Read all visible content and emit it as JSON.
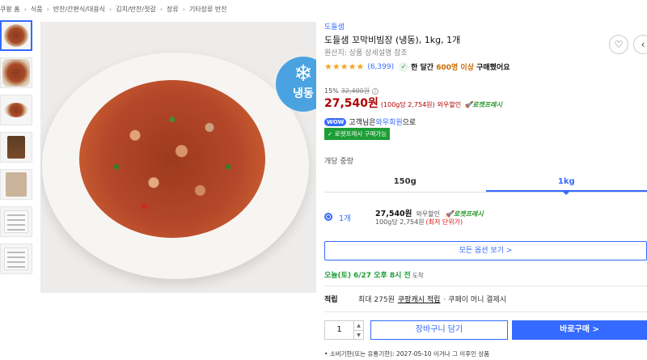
{
  "breadcrumb": [
    "쿠팡 홈",
    "식품",
    "반찬/간편식/대용식",
    "김치/반찬/젓갈",
    "장류",
    "기타장류 반찬"
  ],
  "badge": {
    "freeze_text": "냉동",
    "icon": "snowflake-icon"
  },
  "product": {
    "brand": "도들샘",
    "title": "도들샘 꼬막비빔장 (냉동), 1kg, 1개",
    "origin": "원산지: 상품 상세설명 참조",
    "stars": "★★★★★",
    "review_count": "(6,399)",
    "bought_prefix": "한 달간 ",
    "bought_highlight": "600명 이상",
    "bought_suffix": " 구매했어요"
  },
  "price": {
    "discount_rate": "15%",
    "original": "32,400원",
    "sale": "27,540원",
    "unit": "(100g당 2,754원)",
    "wow_sale": "와우할인",
    "rocket_fresh": "로켓프레시"
  },
  "wow": {
    "badge": "WOW",
    "prefix": "고객님은 ",
    "link": "와우회원",
    "suffix": "으로",
    "rocket_badge": "✓ 로켓프레시 구매가능"
  },
  "weight": {
    "label": "개당 중량",
    "options": [
      "150g",
      "1kg"
    ],
    "selected": "1kg"
  },
  "quantity_option": {
    "label": "1개",
    "price": "27,540원",
    "wow": "와우할인",
    "rocket": "로켓프레시",
    "unit": "100g당 2,754원",
    "lowest": "(최저 단위가)"
  },
  "buttons": {
    "all_options": "모든 옵션 보기 >",
    "cart": "장바구니 담기",
    "buy": "바로구매 >"
  },
  "delivery": {
    "today": "오늘(토)",
    "date": "6/27 오후 8시 전",
    "tail": "도착"
  },
  "points": {
    "title": "적립",
    "prefix": "최대 275원",
    "link": "쿠팡캐시 적립",
    "suffix": "· 쿠페이 머니 결제시"
  },
  "quantity": {
    "value": "1"
  },
  "bullets": [
    "소비기한(또는 유통기한): 2027-05-10 이거나 그 이후인 상품"
  ]
}
